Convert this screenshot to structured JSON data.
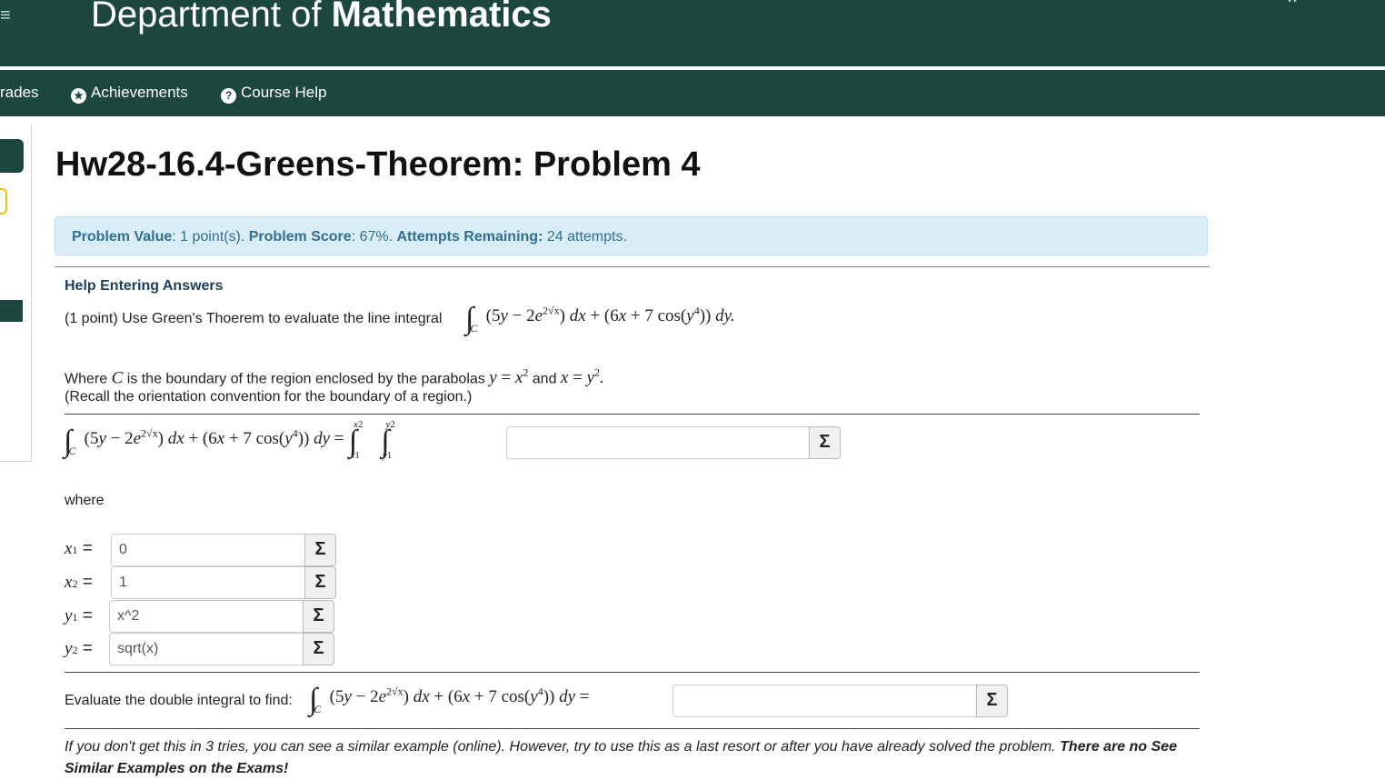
{
  "header": {
    "dept_prefix": "Department of",
    "dept_bold": "Mathematics"
  },
  "nav": {
    "grades_partial": "rades",
    "achievements": "Achievements",
    "course_help": "Course Help",
    "achievements_icon": "star-icon",
    "help_icon": "question-icon"
  },
  "page": {
    "title": "Hw28-16.4-Greens-Theorem: Problem 4"
  },
  "info": {
    "value_label": "Problem Value",
    "value_text": ": 1 point(s).",
    "score_label": "Problem Score",
    "score_text": ": 67%.",
    "attempts_label": "Attempts Remaining:",
    "attempts_text": "24 attempts."
  },
  "problem": {
    "help_link": "Help Entering Answers",
    "intro": "(1 point) Use Green's Thoerem to evaluate the line integral",
    "where_text_1": "Where",
    "where_text_2": "is the boundary of the region enclosed by the parabolas",
    "and_text": "and",
    "recall": "(Recall the orientation convention for the boundary of a region.)",
    "where": "where",
    "evaluate": "Evaluate the double integral to find:",
    "note_italic": "If you don't get this in 3 tries, you can see a similar example (online). However, try to use this as a last resort or after you have already solved the problem.",
    "note_bold": "There are no See Similar Examples on the Exams!"
  },
  "answers": {
    "integrand": "",
    "x1": "0",
    "x2": "1",
    "y1": "x^2",
    "y2": "sqrt(x)",
    "final": ""
  },
  "colors": {
    "header_bg": "#1b473e",
    "info_bg": "#d9edf7",
    "info_text": "#31708f"
  }
}
